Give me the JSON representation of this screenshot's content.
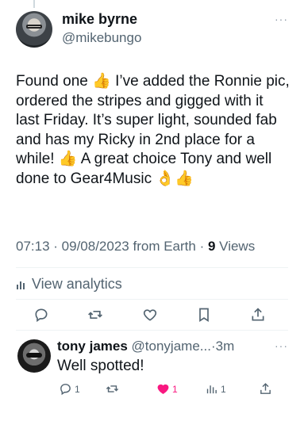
{
  "tweet": {
    "display_name": "mike byrne",
    "handle": "@mikebungo",
    "more_label": "···",
    "body": "Found one 👍 I’ve added the Ronnie pic, ordered the stripes and gigged with it last Friday. It’s super light, sounded fab and has my Ricky in 2nd place for a while! 👍 A great choice Tony and well done to Gear4Music 👌👍",
    "time": "07:13",
    "date": "09/08/2023",
    "source": "from Earth",
    "views_count": "9",
    "views_label": "Views",
    "separator": " · ",
    "analytics_label": "View analytics",
    "actions": [
      "reply-icon",
      "retweet-icon",
      "like-icon",
      "bookmark-icon",
      "share-icon"
    ]
  },
  "reply": {
    "display_name": "tony james",
    "handle": "@tonyjame...",
    "time": "3m",
    "separator": "·",
    "more_label": "···",
    "text": "Well spotted!",
    "reply_count": "1",
    "retweet_count": "",
    "like_count": "1",
    "views_count": "1"
  },
  "colors": {
    "text_primary": "#0f1419",
    "text_secondary": "#536471",
    "like_pink": "#f91880",
    "divider": "#eff3f4"
  }
}
